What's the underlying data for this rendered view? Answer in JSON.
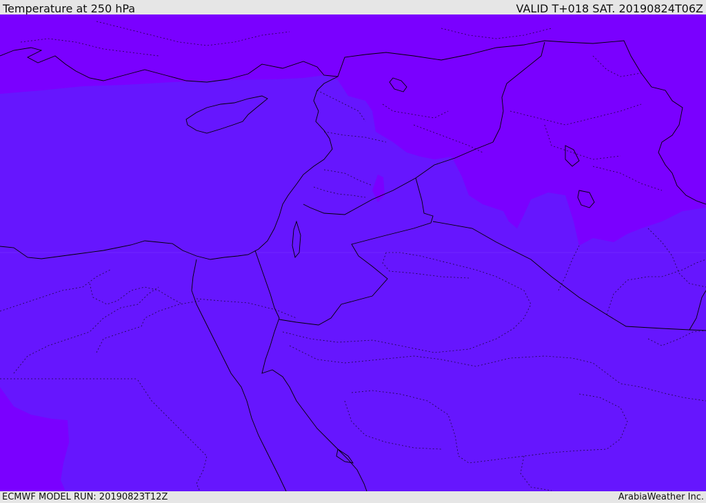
{
  "header": {
    "title": "Temperature at 250 hPa",
    "valid": "VALID T+018 SAT. 20190824T06Z"
  },
  "footer": {
    "model_run": "ECMWF MODEL RUN: 20190823T12Z",
    "brand": "ArabiaWeather Inc."
  },
  "map": {
    "fill_colors": {
      "cold": "#7a00ff",
      "mild": "#6616fe"
    },
    "border_color": "#000000"
  }
}
